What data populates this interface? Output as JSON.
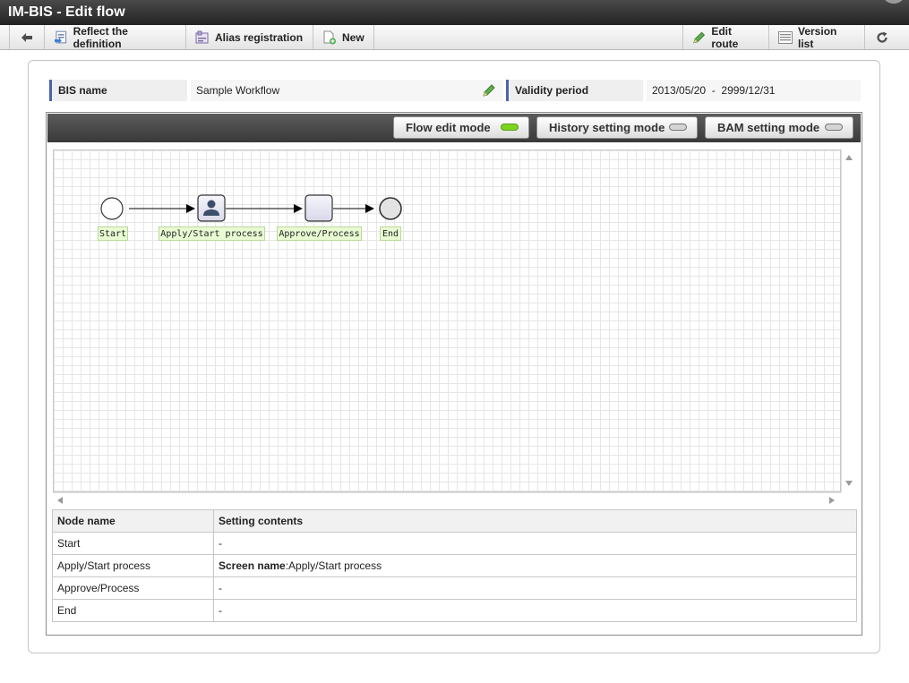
{
  "window": {
    "title": "IM-BIS - Edit flow"
  },
  "toolbar": {
    "back_icon": "arrow-left-icon",
    "reflect_label": "Reflect the definition",
    "alias_label": "Alias registration",
    "new_label": "New",
    "edit_route_label": "Edit route",
    "version_list_label": "Version list",
    "refresh_icon": "refresh-icon"
  },
  "info": {
    "bis_name_label": "BIS name",
    "bis_name_value": "Sample Workflow",
    "validity_label": "Validity period",
    "validity_value": "2013/05/20  -  2999/12/31"
  },
  "modes": {
    "flow_edit": {
      "label": "Flow edit mode",
      "active": true
    },
    "history": {
      "label": "History setting mode",
      "active": false
    },
    "bam": {
      "label": "BAM setting mode",
      "active": false
    }
  },
  "flow": {
    "nodes": [
      {
        "label": "Start",
        "type": "start-event"
      },
      {
        "label": "Apply/Start process",
        "type": "user-task"
      },
      {
        "label": "Approve/Process",
        "type": "task"
      },
      {
        "label": "End",
        "type": "end-event"
      }
    ]
  },
  "table": {
    "headers": [
      "Node name",
      "Setting contents"
    ],
    "rows": [
      {
        "name": "Start",
        "setting_key": "",
        "setting_value": "-"
      },
      {
        "name": "Apply/Start process",
        "setting_key": "Screen name",
        "setting_value": ":Apply/Start process"
      },
      {
        "name": "Approve/Process",
        "setting_key": "",
        "setting_value": "-"
      },
      {
        "name": "End",
        "setting_key": "",
        "setting_value": "-"
      }
    ]
  },
  "colors": {
    "led_on": "#7ed321",
    "led_off": "#d4d4d4",
    "info_label_accent": "#4a64a8",
    "node_label_bg": "#e8fbd3"
  }
}
